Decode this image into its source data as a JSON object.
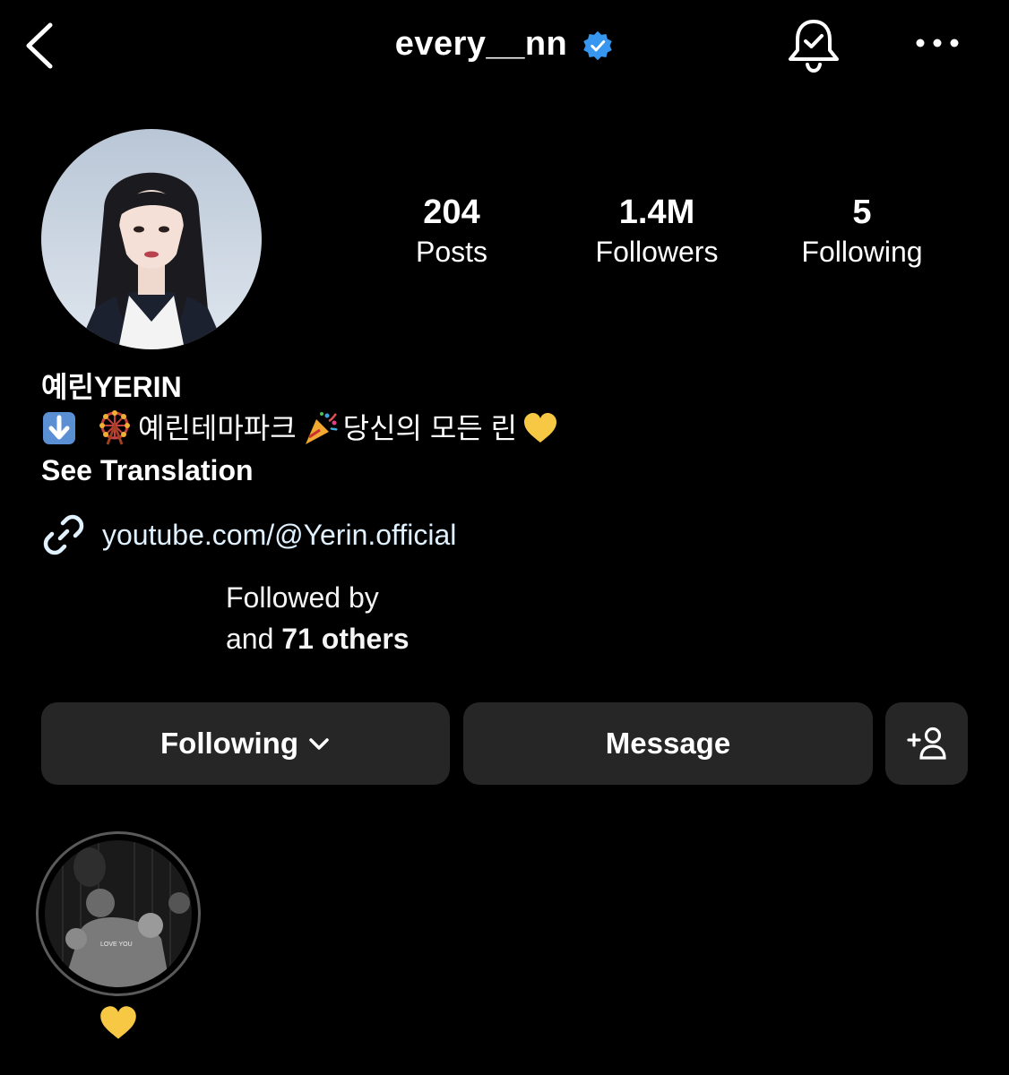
{
  "header": {
    "username": "every__nn",
    "verified": true,
    "icons": {
      "back": "chevron-left-icon",
      "notifications": "bell-check-icon",
      "more": "more-horizontal-icon"
    }
  },
  "profile": {
    "stats": [
      {
        "value": "204",
        "label": "Posts"
      },
      {
        "value": "1.4M",
        "label": "Followers"
      },
      {
        "value": "5",
        "label": "Following"
      }
    ],
    "name": "예린YERIN",
    "bio_text_1": "예린테마파크",
    "bio_text_2": "당신의 모든 린",
    "bio_emojis": [
      "down-arrow-emoji",
      "ferris-wheel-emoji",
      "party-popper-emoji",
      "yellow-heart-emoji"
    ],
    "see_translation": "See Translation",
    "link": "youtube.com/@Yerin.official",
    "followed_by_line1": "Followed by",
    "followed_by_prefix": "and",
    "followed_by_count": "71 others"
  },
  "actions": {
    "following_label": "Following",
    "message_label": "Message",
    "add_person_icon": "add-person-icon"
  },
  "highlights": [
    {
      "label_emoji": "yellow-heart-emoji",
      "image_text": "LOVE YOU"
    }
  ],
  "colors": {
    "background": "#000000",
    "button": "#262626",
    "verified_blue": "#3797f0",
    "heart_yellow": "#f7c843"
  }
}
